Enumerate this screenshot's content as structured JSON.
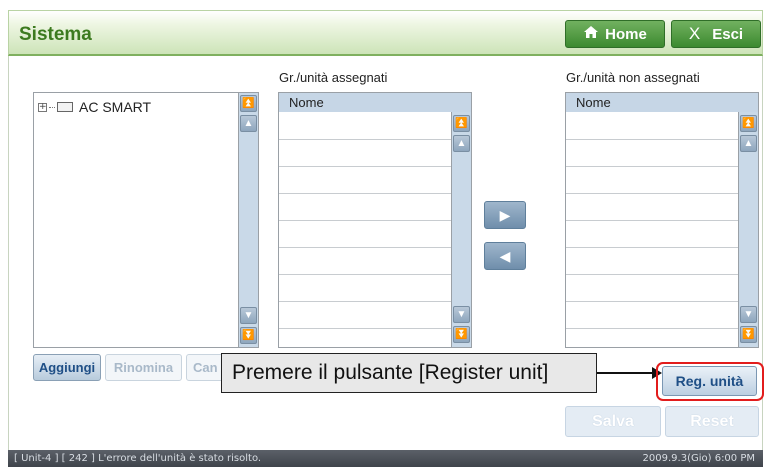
{
  "window": {
    "title": "Sistema"
  },
  "header": {
    "home_label": "Home",
    "exit_label": "Esci",
    "home_icon": "home-icon",
    "exit_icon": "close-icon"
  },
  "tree": {
    "root_label": "AC SMART"
  },
  "assigned": {
    "title": "Gr./unità assegnati",
    "column": "Nome"
  },
  "unassigned": {
    "title": "Gr./unità non assegnati",
    "column": "Nome"
  },
  "tree_buttons": {
    "add": "Aggiungi",
    "rename": "Rinomina",
    "cancel_partial": "Can"
  },
  "callout": {
    "text": "Premere il pulsante [Register unit]"
  },
  "register_button": "Reg. unità",
  "actions": {
    "save": "Salva",
    "reset": "Reset"
  },
  "status": {
    "message": "[ Unit-4 ] [ 242 ] L'errore dell'unità è stato risolto.",
    "datetime": "2009.9.3(Gio)  6:00 PM"
  },
  "colors": {
    "title_green": "#3c7a1f",
    "button_green": "#3c8a2f",
    "highlight_red": "#e21c1c",
    "accent_blue": "#1f4f86"
  }
}
